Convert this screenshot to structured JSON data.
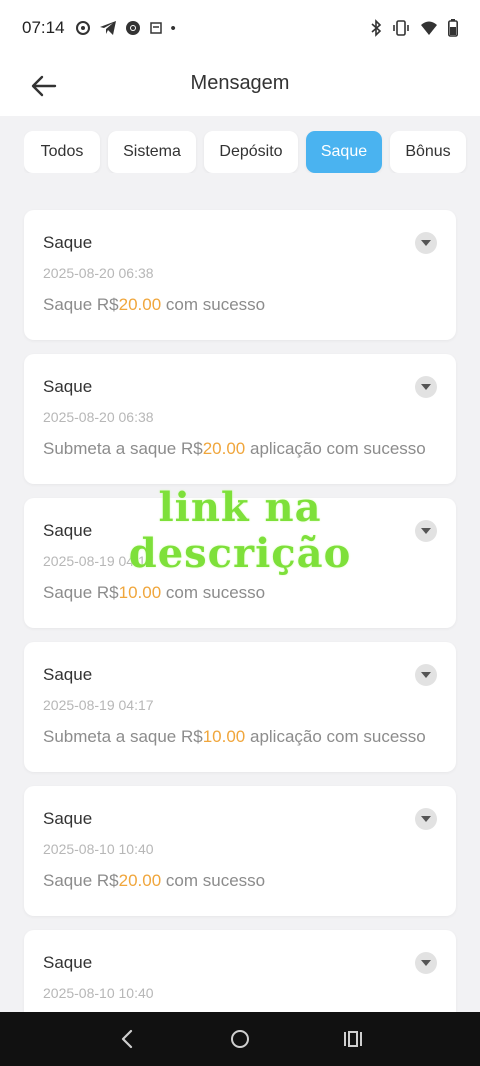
{
  "status_bar": {
    "time": "07:14",
    "left_icons": [
      "settings-icon",
      "telegram-icon",
      "chrome-icon",
      "notification-icon",
      "dot-icon"
    ],
    "dot": "•",
    "right_icons": [
      "bluetooth-icon",
      "vibrate-icon",
      "wifi-icon",
      "battery-icon"
    ]
  },
  "header": {
    "title": "Mensagem",
    "back_icon": "arrow-left-icon"
  },
  "tabs": [
    {
      "label": "Todos",
      "active": false
    },
    {
      "label": "Sistema",
      "active": false
    },
    {
      "label": "Depósito",
      "active": false
    },
    {
      "label": "Saque",
      "active": true
    },
    {
      "label": "Bônus",
      "active": false
    }
  ],
  "messages": [
    {
      "title": "Saque",
      "date": "2025-08-20 06:38",
      "prefix": "Saque R$",
      "amount": "20.00",
      "suffix": " com sucesso"
    },
    {
      "title": "Saque",
      "date": "2025-08-20 06:38",
      "prefix": "Submeta a saque R$",
      "amount": "20.00",
      "suffix": " aplicação com sucesso"
    },
    {
      "title": "Saque",
      "date": "2025-08-19 04:17",
      "prefix": "Saque R$",
      "amount": "10.00",
      "suffix": " com sucesso"
    },
    {
      "title": "Saque",
      "date": "2025-08-19 04:17",
      "prefix": "Submeta a saque R$",
      "amount": "10.00",
      "suffix": " aplicação com sucesso"
    },
    {
      "title": "Saque",
      "date": "2025-08-10 10:40",
      "prefix": "Saque R$",
      "amount": "20.00",
      "suffix": " com sucesso"
    },
    {
      "title": "Saque",
      "date": "2025-08-10 10:40",
      "prefix": "",
      "amount": "",
      "suffix": ""
    }
  ],
  "overlay": {
    "line1": "link na",
    "line2": "descrição"
  },
  "colors": {
    "accent": "#4ab3f0",
    "amount": "#f0a63c",
    "overlay": "#7ee03a"
  },
  "nav": {
    "back": "nav-back-icon",
    "home": "nav-home-icon",
    "recents": "nav-recents-icon"
  }
}
